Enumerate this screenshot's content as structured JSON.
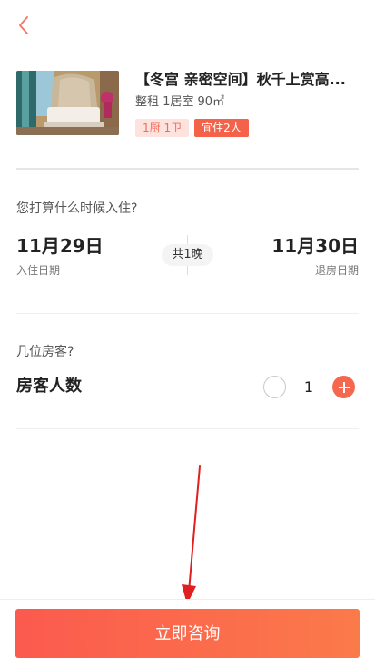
{
  "header": {
    "back_icon": "chevron-left-icon",
    "accent_color": "#f26b5b"
  },
  "listing": {
    "title": "【冬宫 亲密空间】秋千上赏高...",
    "subtitle": "整租 1居室 90㎡",
    "tags": [
      "1厨 1卫",
      "宜住2人"
    ]
  },
  "stay": {
    "question": "您打算什么时候入住?",
    "checkin_date": "11月29日",
    "checkin_label": "入住日期",
    "nights": "共1晚",
    "checkout_date": "11月30日",
    "checkout_label": "退房日期"
  },
  "guests": {
    "question": "几位房客?",
    "label": "房客人数",
    "count": "1"
  },
  "footer": {
    "consult_label": "立即咨询",
    "button_colors": [
      "#fb5a4e",
      "#fb7a4a"
    ]
  },
  "annotation": {
    "arrow_color": "#e02020"
  }
}
